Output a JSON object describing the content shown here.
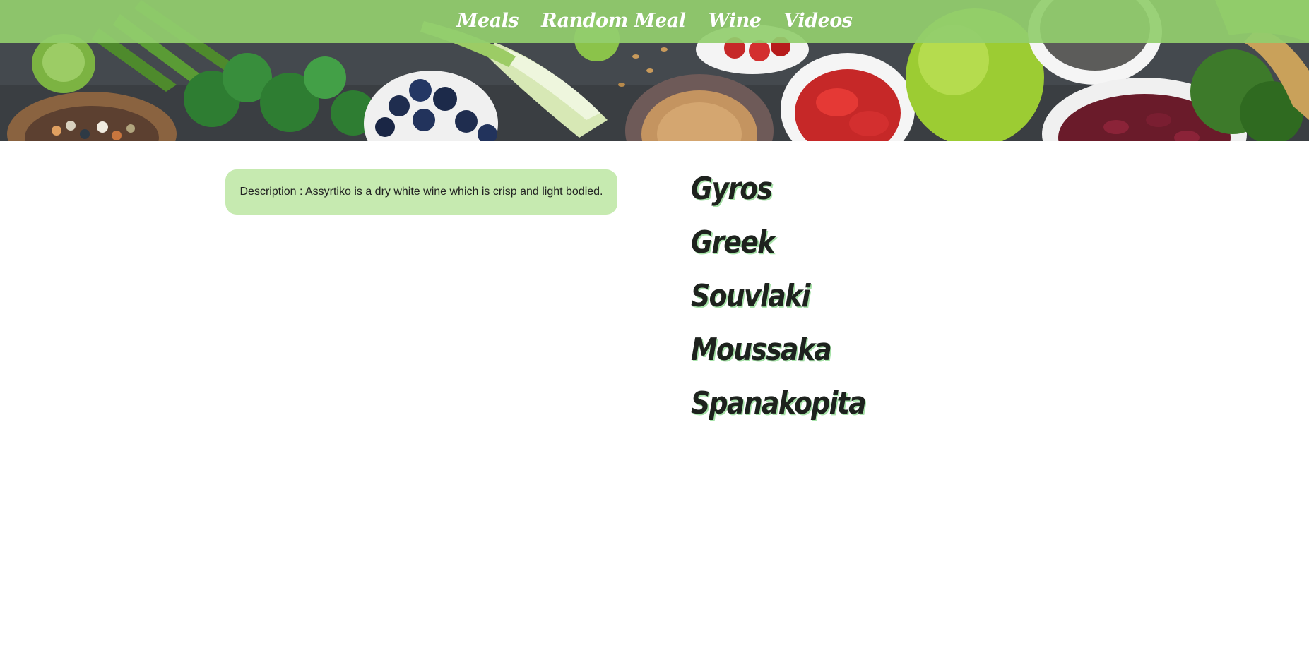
{
  "nav": {
    "items": [
      {
        "label": "Meals"
      },
      {
        "label": "Random Meal"
      },
      {
        "label": "Wine"
      },
      {
        "label": "Videos"
      }
    ]
  },
  "description": {
    "text": "Description : Assyrtiko is a dry white wine which is crisp and light bodied."
  },
  "meals": [
    {
      "label": "Gyros"
    },
    {
      "label": "Greek"
    },
    {
      "label": "Souvlaki"
    },
    {
      "label": "Moussaka"
    },
    {
      "label": "Spanakopita"
    }
  ],
  "colors": {
    "nav_background": "#92ce6e",
    "description_background": "#c6eab0",
    "meal_text": "#1e221e",
    "meal_shadow": "#a6e2a8"
  }
}
